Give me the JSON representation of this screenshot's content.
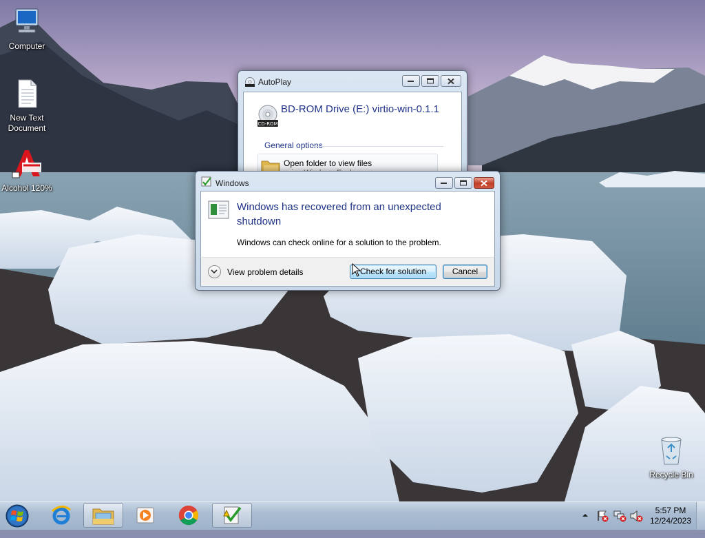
{
  "desktop": {
    "icons": [
      {
        "label": "Computer"
      },
      {
        "label": "New Text\nDocument",
        "line1": "New Text",
        "line2": "Document"
      },
      {
        "label": "Alcohol 120%"
      },
      {
        "label": "Recycle Bin"
      }
    ]
  },
  "autoplay": {
    "title": "AutoPlay",
    "drive_label": "BD-ROM Drive (E:) virtio-win-0.1.1",
    "cd_badge": "CD-ROM",
    "group_title": "General options",
    "option_label": "Open folder to view files",
    "option_sub": "using Windows Explorer"
  },
  "error_dialog": {
    "title": "Windows",
    "heading": "Windows has recovered from an unexpected shutdown",
    "message": "Windows can check online for a solution to the problem.",
    "details_label": "View problem details",
    "check_button": "Check for solution",
    "cancel_button": "Cancel"
  },
  "taskbar": {
    "pinned": [
      "start-orb",
      "internet-explorer",
      "windows-explorer",
      "media-player",
      "chrome",
      "problem-reports"
    ],
    "clock_time": "5:57 PM",
    "clock_date": "12/24/2023"
  },
  "colors": {
    "heading_blue": "#1e3287",
    "close_red": "#c0402a",
    "taskbar": "#a9bcd2"
  }
}
